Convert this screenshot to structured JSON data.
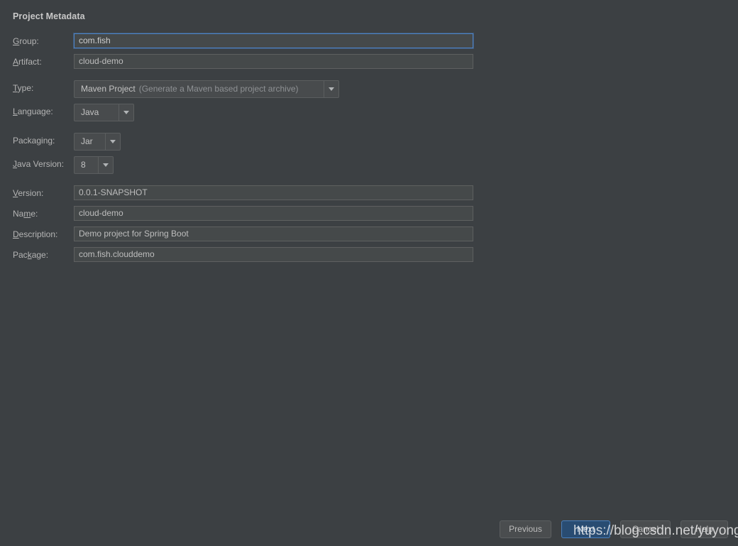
{
  "window": {
    "theme_background": "#3c4043",
    "accent_color": "#4d84c8"
  },
  "form": {
    "section_title": "Project Metadata",
    "fields": [
      {
        "label": "Group:",
        "mnemonic": "G",
        "kind": "text",
        "value": "com.fish",
        "focused": true
      },
      {
        "label": "Artifact:",
        "mnemonic": "A",
        "kind": "text",
        "value": "cloud-demo",
        "focused": false
      },
      {
        "label": "Type:",
        "mnemonic": "T",
        "kind": "combo",
        "value": "Maven Project",
        "value_hint": "(Generate a Maven based project archive)"
      },
      {
        "label": "Language:",
        "mnemonic": "L",
        "kind": "combo",
        "value": "Java",
        "value_hint": ""
      },
      {
        "label": "Packaging:",
        "mnemonic": "g",
        "kind": "combo",
        "value": "Jar",
        "value_hint": ""
      },
      {
        "label": "Java Version:",
        "mnemonic": "J",
        "kind": "combo",
        "value": "8",
        "value_hint": ""
      },
      {
        "label": "Version:",
        "mnemonic": "V",
        "kind": "text",
        "value": "0.0.1-SNAPSHOT",
        "focused": false
      },
      {
        "label": "Name:",
        "mnemonic": "m",
        "kind": "text",
        "value": "cloud-demo",
        "focused": false
      },
      {
        "label": "Description:",
        "mnemonic": "D",
        "kind": "text",
        "value": "Demo project for Spring Boot",
        "focused": false
      },
      {
        "label": "Package:",
        "mnemonic": "k",
        "kind": "text",
        "value": "com.fish.clouddemo",
        "focused": false
      }
    ]
  },
  "buttons": {
    "previous": "Previous",
    "next": "Next",
    "cancel": "Cancel",
    "help": "Help"
  },
  "watermark": {
    "text": "https://blog.csdn.net/yuyongqun"
  },
  "icons": {
    "combo_arrow": "chevron-down-icon"
  }
}
